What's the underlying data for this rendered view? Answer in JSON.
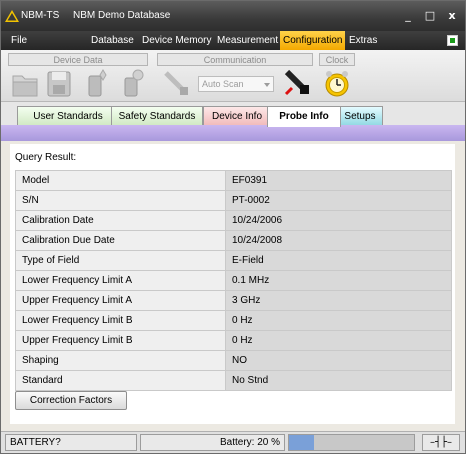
{
  "titlebar": {
    "app_name": "NBM-TS",
    "db_name": "NBM Demo Database",
    "minimize": "_",
    "maximize": "□",
    "close": "x"
  },
  "menu": {
    "file": "File",
    "database": "Database",
    "device_memory": "Device Memory",
    "measurement": "Measurement",
    "configuration": "Configuration",
    "extras": "Extras"
  },
  "ribbon": {
    "groups": {
      "device_data": "Device Data",
      "communication": "Communication",
      "clock": "Clock"
    },
    "autoscan": "Auto Scan"
  },
  "tabs": {
    "user_standards": "User Standards",
    "safety_standards": "Safety Standards",
    "device_info": "Device Info",
    "probe_info": "Probe Info",
    "setups": "Setups"
  },
  "content": {
    "query_label": "Query Result:",
    "rows": [
      {
        "key": "Model",
        "value": "EF0391"
      },
      {
        "key": "S/N",
        "value": "PT-0002"
      },
      {
        "key": "Calibration Date",
        "value": "10/24/2006"
      },
      {
        "key": "Calibration Due Date",
        "value": "10/24/2008"
      },
      {
        "key": "Type of Field",
        "value": "E-Field"
      },
      {
        "key": "Lower Frequency Limit A",
        "value": "0.1 MHz"
      },
      {
        "key": "Upper Frequency Limit A",
        "value": "3 GHz"
      },
      {
        "key": "Lower Frequency Limit B",
        "value": "0 Hz"
      },
      {
        "key": "Upper Frequency Limit B",
        "value": "0 Hz"
      },
      {
        "key": "Shaping",
        "value": "NO"
      },
      {
        "key": "Standard",
        "value": "No Stnd"
      }
    ],
    "correction_button": "Correction Factors"
  },
  "status": {
    "battery_state": "BATTERY?",
    "battery_text": "Battery: 20 %",
    "battery_level": 0.2,
    "power_icon": "plug-icon"
  },
  "colors": {
    "accent": "#f3a900",
    "band": "#b6a5e6",
    "tab_device_info": "#f5c9c9",
    "tab_setups": "#9ee0e6"
  }
}
